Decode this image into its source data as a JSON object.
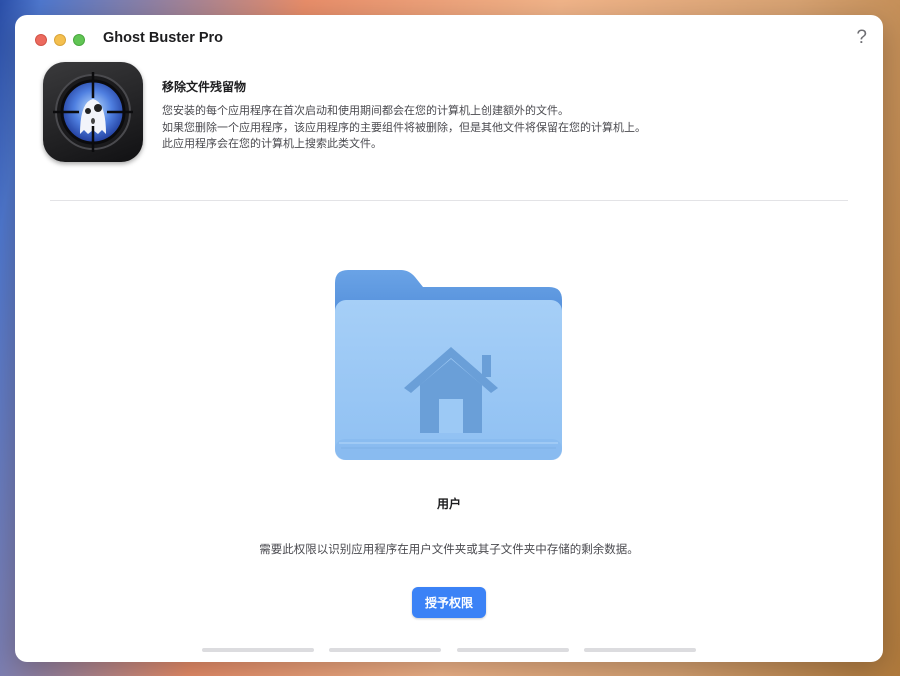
{
  "window": {
    "title": "Ghost Buster Pro",
    "help_glyph": "?"
  },
  "header": {
    "icon": "ghost-crosshair-app-icon",
    "title": "移除文件残留物",
    "lines": [
      "您安装的每个应用程序在首次启动和使用期间都会在您的计算机上创建额外的文件。",
      "如果您删除一个应用程序，该应用程序的主要组件将被删除，但是其他文件将保留在您的计算机上。",
      "此应用程序会在您的计算机上搜索此类文件。"
    ]
  },
  "main": {
    "folder_icon": "home-folder-icon",
    "folder_label": "用户",
    "description": "需要此权限以识别应用程序在用户文件夹或其子文件夹中存储的剩余数据。",
    "grant_button": "授予权限"
  },
  "pager": {
    "steps": 4
  },
  "colors": {
    "accent": "#3b82f6",
    "folder": "#9cc9f5",
    "folder_tab": "#5f9ae0"
  }
}
